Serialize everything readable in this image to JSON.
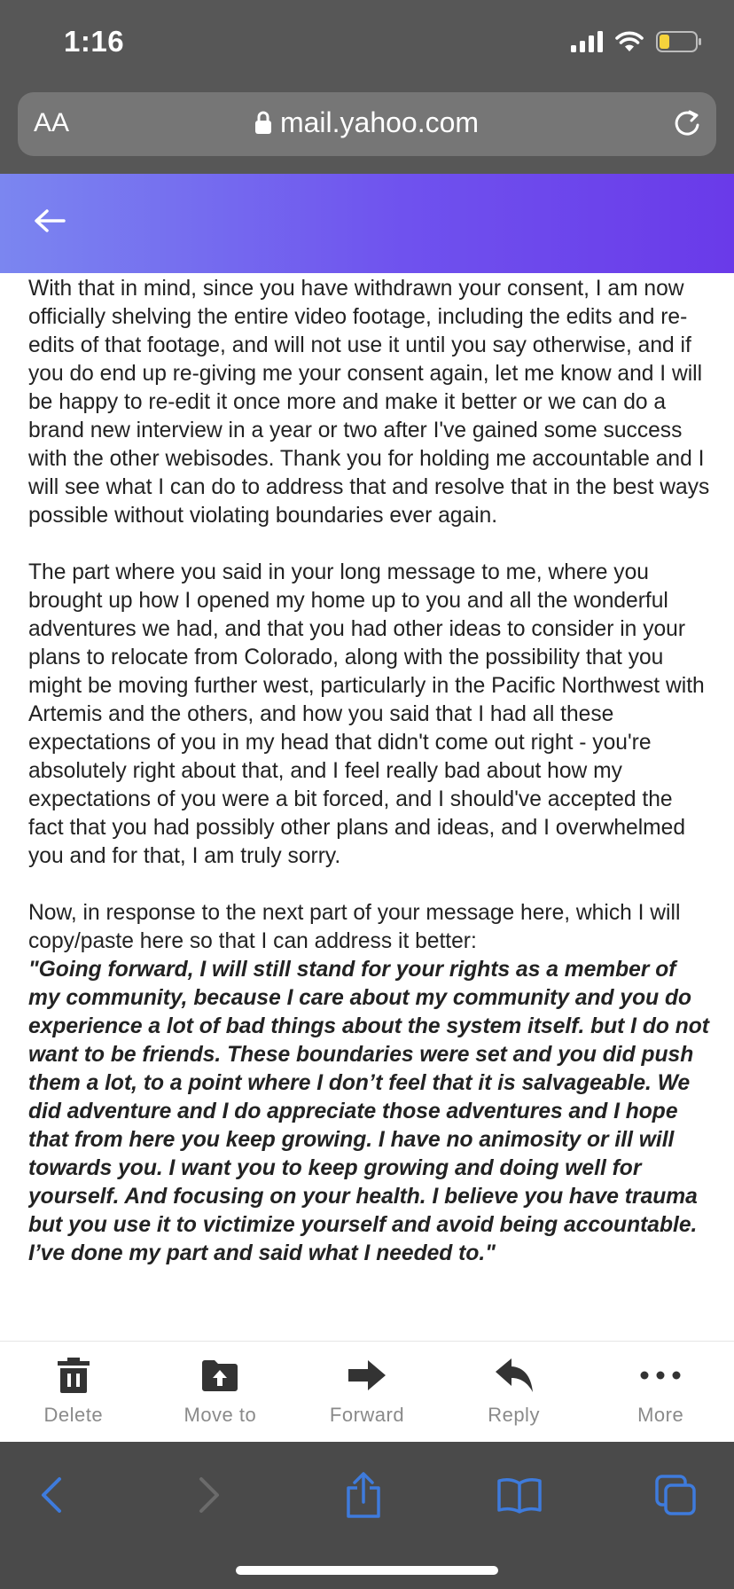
{
  "status_bar": {
    "time": "1:16",
    "battery_level": 0.25
  },
  "browser": {
    "text_size_label": "AA",
    "url": "mail.yahoo.com"
  },
  "message": {
    "paragraphs": [
      "With that in mind, since you have withdrawn your consent, I am now officially shelving the entire video footage, including the edits and re-edits of that footage, and will not use it until you say otherwise, and if you do end up re-giving me your consent again, let me know and I will be happy to re-edit it once more and make it better or we can do a brand new interview in a year or two after I've gained some success with the other webisodes. Thank you for holding me accountable and I will see what I can do to address that and resolve that in the best ways possible without violating boundaries ever again.",
      "The part where you said in your long message to me, where you brought up how I opened my home up to you and all the wonderful adventures we had, and that you had other ideas to consider in your plans to relocate from Colorado, along with the possibility that you might be moving further west, particularly in the Pacific Northwest with Artemis and the others, and how you said that I had all these expectations of you in my head that didn't come out right - you're absolutely right about that, and I feel really bad about how my expectations of you were a bit forced, and I should've accepted the fact that you had possibly other plans and ideas, and I overwhelmed you and for that, I am truly sorry."
    ],
    "intro": "Now, in response to the next part of your message here, which I will copy/paste here so that I can address it better:",
    "quote": "\"Going forward, I will still stand for your rights as a member of my community, because I care about my community and you do experience a lot of bad things about the system itself. but I do not want to be friends. These boundaries were set and you did push them a lot, to a point where I don’t feel that it is salvageable. We did adventure and I do appreciate those adventures and I hope that from here you keep growing. I have no animosity or ill will towards you. I want you to keep growing and doing well for yourself. And focusing on your health. I believe you have trauma but you use it to victimize yourself and avoid being accountable. I’ve done my part and said what I needed to.\""
  },
  "actions": {
    "delete": "Delete",
    "move_to": "Move to",
    "forward": "Forward",
    "reply": "Reply",
    "more": "More"
  },
  "colors": {
    "header_gradient_start": "#7b86f0",
    "header_gradient_end": "#6a3ae9",
    "safari_icon_blue": "#3e7bdc",
    "battery_yellow": "#f5d33c"
  }
}
